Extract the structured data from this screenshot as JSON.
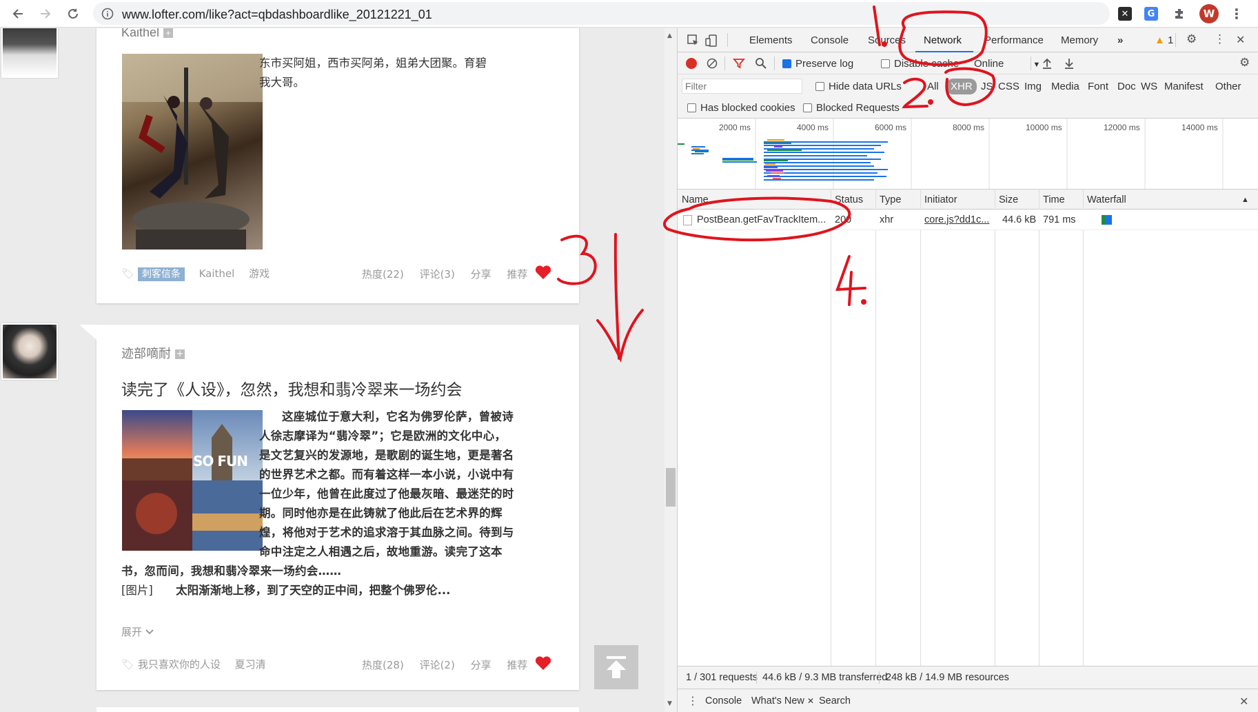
{
  "browser": {
    "url": "www.lofter.com/like?act=qbdashboardlike_20121221_01",
    "profile_initial": "W"
  },
  "posts": [
    {
      "author": "Kaithel",
      "excerpt": "东市买阿姐，西市买阿弟，姐弟大团聚。育碧我大哥。",
      "tags": [
        "刺客信条",
        "Kaithel",
        "游戏"
      ],
      "stats": {
        "hot": "热度(22)",
        "comment": "评论(3)",
        "share": "分享",
        "recommend": "推荐"
      }
    },
    {
      "author": "迹部嘀耐",
      "title": "读完了《人设》，忽然，我想和翡冷翠来一场约会",
      "image_caption": "SO FUN",
      "body_lines": [
        "这座城位于意大利，它名为佛罗伦萨，曾被诗",
        "人徐志摩译为“翡冷翠”；它是欧洲的文化中心，",
        "是文艺复兴的发源地，是歌剧的诞生地，更是著名",
        "的世界艺术之都。而有着这样一本小说，小说中有",
        "一位少年，他曾在此度过了他最灰暗、最迷茫的时",
        "期。同时他亦是在此铸就了他此后在艺术界的辉",
        "煌，将他对于艺术的追求溶于其血脉之间。待到与",
        "命中注定之人相遇之后，故地重游。读完了这本",
        "书，忽而间，我想和翡冷翠来一场约会……"
      ],
      "img_label": "[图片]",
      "last_line": "太阳渐渐地上移，到了天空的正中间，把整个佛罗伦...",
      "expand": "展开",
      "tags": [
        "我只喜欢你的人设",
        "夏习清"
      ],
      "stats": {
        "hot": "热度(28)",
        "comment": "评论(2)",
        "share": "分享",
        "recommend": "推荐"
      }
    }
  ],
  "devtools": {
    "tabs": [
      "Elements",
      "Console",
      "Sources",
      "Network",
      "Performance",
      "Memory"
    ],
    "active_tab": "Network",
    "warning_count": "1",
    "preserve_log": "Preserve log",
    "disable_cache": "Disable cache",
    "throttle": "Online",
    "filter_placeholder": "Filter",
    "hide_data_urls": "Hide data URLs",
    "type_filters": [
      "All",
      "XHR",
      "JS",
      "CSS",
      "Img",
      "Media",
      "Font",
      "Doc",
      "WS",
      "Manifest",
      "Other"
    ],
    "active_filter": "XHR",
    "has_blocked_cookies": "Has blocked cookies",
    "blocked_requests": "Blocked Requests",
    "timeline_ticks": [
      "2000 ms",
      "4000 ms",
      "6000 ms",
      "8000 ms",
      "10000 ms",
      "12000 ms",
      "14000 ms"
    ],
    "columns": [
      "Name",
      "Status",
      "Type",
      "Initiator",
      "Size",
      "Time",
      "Waterfall"
    ],
    "requests": [
      {
        "name": "PostBean.getFavTrackItem...",
        "status": "200",
        "type": "xhr",
        "initiator": "core.js?dd1c...",
        "size": "44.6 kB",
        "time": "791 ms"
      }
    ],
    "status": {
      "requests": "1 / 301 requests",
      "transferred": "44.6 kB / 9.3 MB transferred",
      "resources": "248 kB / 14.9 MB resources"
    },
    "drawer_tabs": [
      "Console",
      "What's New",
      "Search"
    ]
  },
  "annotations": [
    "1.",
    "2.",
    "3",
    "4."
  ],
  "colors": {
    "annotation_red": "#e0141e",
    "xhr_pill": "#9a9a9a",
    "record_red": "#d93025",
    "like_red": "#e61e28"
  }
}
